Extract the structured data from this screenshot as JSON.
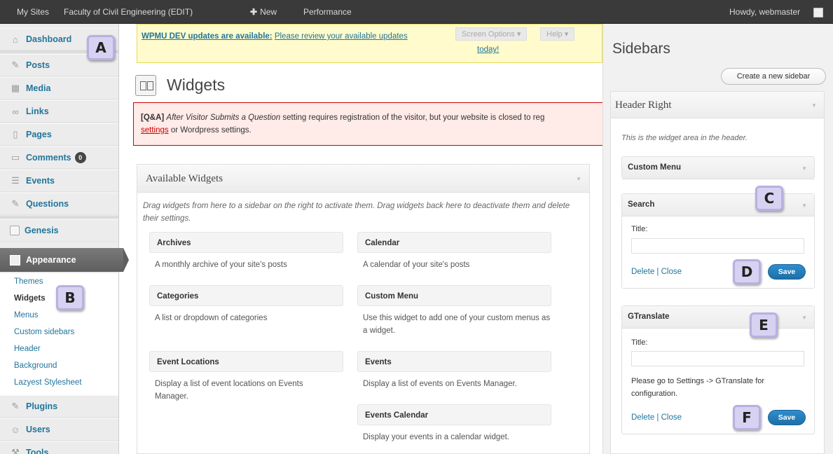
{
  "adminbar": {
    "my_sites": "My Sites",
    "site_name": "Faculty of Civil Engineering (EDIT)",
    "new_label": "New",
    "performance": "Performance",
    "howdy": "Howdy, webmaster"
  },
  "menu": {
    "dashboard": "Dashboard",
    "posts": "Posts",
    "media": "Media",
    "links": "Links",
    "pages": "Pages",
    "comments": "Comments",
    "comments_count": "0",
    "events": "Events",
    "questions": "Questions",
    "genesis": "Genesis",
    "appearance": "Appearance",
    "plugins": "Plugins",
    "users": "Users",
    "tools": "Tools"
  },
  "appearance_submenu": {
    "themes": "Themes",
    "widgets": "Widgets",
    "menus": "Menus",
    "custom_sidebars": "Custom sidebars",
    "header": "Header",
    "background": "Background",
    "lazyest": "Lazyest Stylesheet"
  },
  "callouts": {
    "a": "A",
    "b": "B",
    "c": "C",
    "d": "D",
    "e": "E",
    "f": "F"
  },
  "notice": {
    "strong": "WPMU DEV updates are available:",
    "text": "Please review your available updates",
    "today": "today!"
  },
  "screen_options": "Screen Options",
  "help": "Help",
  "page_title": "Widgets",
  "error": {
    "tag": "[Q&A]",
    "setting_name": "After Visitor Submits a Question",
    "text": "setting requires registration of the visitor, but your website is closed to reg",
    "link": "settings",
    "tail": "or Wordpress settings."
  },
  "available": {
    "title": "Available Widgets",
    "description": "Drag widgets from here to a sidebar on the right to activate them. Drag widgets back here to deactivate them and delete their settings.",
    "widgets": [
      {
        "name": "Archives",
        "desc": "A monthly archive of your site's posts"
      },
      {
        "name": "Calendar",
        "desc": "A calendar of your site's posts"
      },
      {
        "name": "Categories",
        "desc": "A list or dropdown of categories"
      },
      {
        "name": "Custom Menu",
        "desc": "Use this widget to add one of your custom menus as a widget."
      },
      {
        "name": "Event Locations",
        "desc": "Display a list of event locations on Events Manager."
      },
      {
        "name": "Events",
        "desc": "Display a list of events on Events Manager."
      },
      {
        "name": "Events Calendar",
        "desc": "Display your events in a calendar widget."
      }
    ]
  },
  "sidebars": {
    "title": "Sidebars",
    "create_button": "Create a new sidebar",
    "header_right": {
      "title": "Header Right",
      "description": "This is the widget area in the header.",
      "custom_menu": "Custom Menu",
      "search": {
        "title": "Search",
        "title_label": "Title:",
        "title_value": "",
        "delete_close": "Delete | Close",
        "save": "Save"
      },
      "gtranslate": {
        "title": "GTranslate",
        "title_label": "Title:",
        "title_value": "",
        "note": "Please go to Settings -> GTranslate for configuration.",
        "delete_close": "Delete | Close",
        "save": "Save"
      }
    }
  }
}
